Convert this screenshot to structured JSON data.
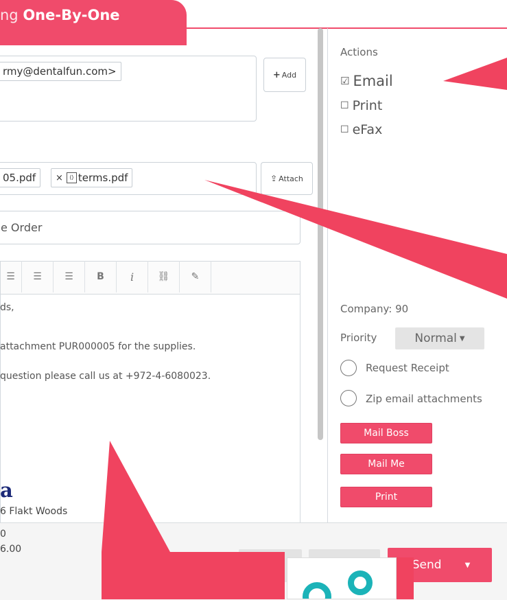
{
  "header": {
    "title_prefix": "ng",
    "title_bold": "One-By-One"
  },
  "recipients": {
    "chip_text": "rmy@dentalfun.com>",
    "add_label": "Add"
  },
  "attachments": {
    "chip1": "05.pdf",
    "chip2": "terms.pdf",
    "remove_glyph": "×",
    "attach_label": "Attach"
  },
  "subject": {
    "value": "e Order"
  },
  "toolbar": {
    "buttons": [
      "bulleted-list",
      "numbered-list",
      "indent",
      "bold",
      "italic",
      "link",
      "pencil"
    ],
    "bold_glyph": "B",
    "italic_glyph": "i"
  },
  "editor": {
    "line1": "ds,",
    "line2": "attachment PUR000005 for the supplies.",
    "line3": "question please call us at +972-4-6080023.",
    "signature_glyph": "a"
  },
  "sidebar": {
    "actions_title": "Actions",
    "actions": [
      {
        "label": "Email",
        "checked": true
      },
      {
        "label": "Print",
        "checked": false
      },
      {
        "label": "eFax",
        "checked": false
      }
    ],
    "company_label": "Company: 90",
    "priority_label": "Priority",
    "priority_value": "Normal",
    "request_receipt": "Request Receipt",
    "zip_label": "Zip email attachments",
    "mail_boss": "Mail Boss",
    "mail_me": "Mail Me",
    "print": "Print"
  },
  "footer": {
    "line1": "6 Flakt Woods",
    "line2": "0",
    "line3": "6.00",
    "send_label": "Send"
  },
  "colors": {
    "accent": "#f04b6b",
    "divider": "#d5dadf"
  }
}
